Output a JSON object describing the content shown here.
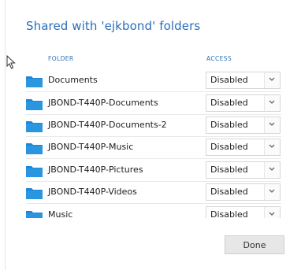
{
  "dialog": {
    "title": "Shared with 'ejkbond' folders",
    "columns": {
      "folder": "FOLDER",
      "access": "ACCESS"
    },
    "rows": [
      {
        "name": "Documents",
        "access": "Disabled",
        "icon": "folder-icon"
      },
      {
        "name": "JBOND-T440P-Documents",
        "access": "Disabled",
        "icon": "folder-icon"
      },
      {
        "name": "JBOND-T440P-Documents-2",
        "access": "Disabled",
        "icon": "folder-icon"
      },
      {
        "name": "JBOND-T440P-Music",
        "access": "Disabled",
        "icon": "folder-icon"
      },
      {
        "name": "JBOND-T440P-Pictures",
        "access": "Disabled",
        "icon": "folder-icon"
      },
      {
        "name": "JBOND-T440P-Videos",
        "access": "Disabled",
        "icon": "folder-icon"
      },
      {
        "name": "Music",
        "access": "Disabled",
        "icon": "folder-icon"
      }
    ],
    "done_label": "Done",
    "colors": {
      "accent": "#2a6ebb",
      "folder": "#1e88d6",
      "button_bg": "#e7e7e7"
    }
  }
}
